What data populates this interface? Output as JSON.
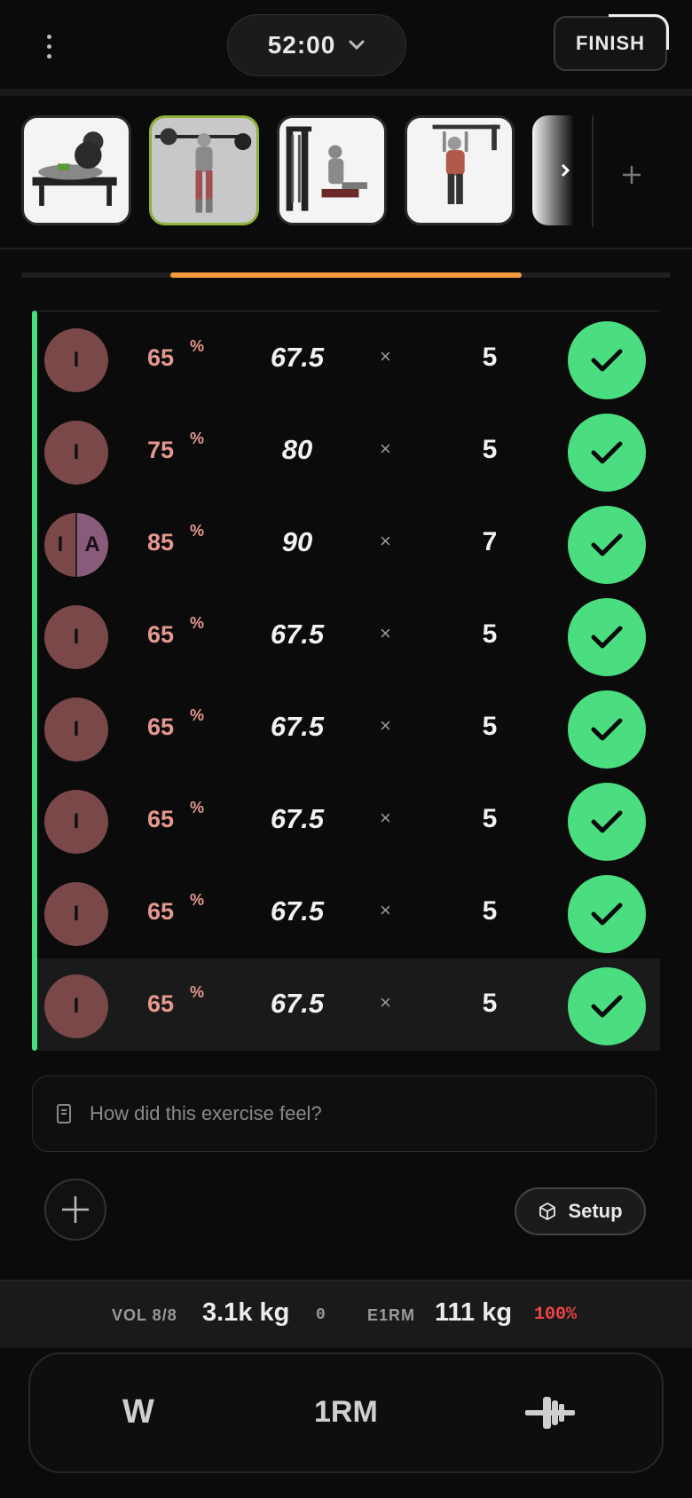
{
  "header": {
    "timer": "52:00",
    "finish_label": "FINISH"
  },
  "exercises": [
    {
      "name_icon": "bench-press-icon",
      "active": false
    },
    {
      "name_icon": "barbell-squat-icon",
      "active": true
    },
    {
      "name_icon": "seated-cable-row-icon",
      "active": false
    },
    {
      "name_icon": "pull-up-icon",
      "active": false
    }
  ],
  "exercise_progress": 0.5,
  "sets": [
    {
      "badge": [
        "I"
      ],
      "pct": "65",
      "pct_sign": "%",
      "weight": "67.5",
      "times": "×",
      "reps": "5",
      "done": true
    },
    {
      "badge": [
        "I"
      ],
      "pct": "75",
      "pct_sign": "%",
      "weight": "80",
      "times": "×",
      "reps": "5",
      "done": true
    },
    {
      "badge": [
        "I",
        "A"
      ],
      "pct": "85",
      "pct_sign": "%",
      "weight": "90",
      "times": "×",
      "reps": "7",
      "done": true
    },
    {
      "badge": [
        "I"
      ],
      "pct": "65",
      "pct_sign": "%",
      "weight": "67.5",
      "times": "×",
      "reps": "5",
      "done": true
    },
    {
      "badge": [
        "I"
      ],
      "pct": "65",
      "pct_sign": "%",
      "weight": "67.5",
      "times": "×",
      "reps": "5",
      "done": true
    },
    {
      "badge": [
        "I"
      ],
      "pct": "65",
      "pct_sign": "%",
      "weight": "67.5",
      "times": "×",
      "reps": "5",
      "done": true
    },
    {
      "badge": [
        "I"
      ],
      "pct": "65",
      "pct_sign": "%",
      "weight": "67.5",
      "times": "×",
      "reps": "5",
      "done": true
    },
    {
      "badge": [
        "I"
      ],
      "pct": "65",
      "pct_sign": "%",
      "weight": "67.5",
      "times": "×",
      "reps": "5",
      "done": true
    }
  ],
  "note": {
    "placeholder": "How did this exercise feel?"
  },
  "actions": {
    "setup_label": "Setup"
  },
  "stats": {
    "vol_label": "VOL 8/8",
    "vol_value": "3.1k kg",
    "vol_delta": "0",
    "e1rm_label": "E1RM",
    "e1rm_value": "111 kg",
    "e1rm_pct": "100%"
  },
  "bottom_nav": {
    "w_label": "W",
    "rm_label": "1RM"
  },
  "colors": {
    "accent_green": "#4ade80",
    "accent_orange": "#f39a3d",
    "pct_pink": "#e4988f",
    "warn_red": "#ef4444"
  }
}
